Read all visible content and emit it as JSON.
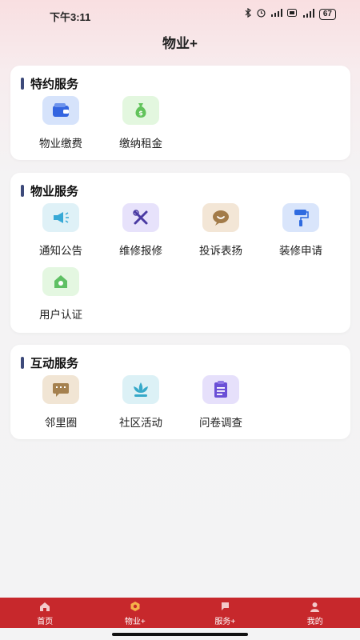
{
  "status": {
    "time": "下午3:11",
    "battery": "67"
  },
  "page": {
    "title": "物业+"
  },
  "sections": {
    "special": {
      "title": "特约服务",
      "items": [
        {
          "label": "物业缴费",
          "icon": "wallet-icon",
          "bg": "#d6e3fb",
          "fg": "#3465e0"
        },
        {
          "label": "缴纳租金",
          "icon": "money-bag-icon",
          "bg": "#e3f7df",
          "fg": "#62c35b"
        }
      ]
    },
    "property": {
      "title": "物业服务",
      "items": [
        {
          "label": "通知公告",
          "icon": "megaphone-icon",
          "bg": "#dff1f7",
          "fg": "#38a9d6"
        },
        {
          "label": "维修报修",
          "icon": "tools-icon",
          "bg": "#e7e2fb",
          "fg": "#4a3aa3"
        },
        {
          "label": "投诉表扬",
          "icon": "chat-smile-icon",
          "bg": "#f3e6d6",
          "fg": "#a27b49"
        },
        {
          "label": "装修申请",
          "icon": "paint-roller-icon",
          "bg": "#d9e5fb",
          "fg": "#2f6be0"
        },
        {
          "label": "用户认证",
          "icon": "home-verify-icon",
          "bg": "#e4f7e1",
          "fg": "#5fc064"
        }
      ]
    },
    "interactive": {
      "title": "互动服务",
      "items": [
        {
          "label": "邻里圈",
          "icon": "message-card-icon",
          "bg": "#f1e5d4",
          "fg": "#a5814f"
        },
        {
          "label": "社区活动",
          "icon": "lotus-icon",
          "bg": "#dcf1f6",
          "fg": "#36a9c9"
        },
        {
          "label": "问卷调查",
          "icon": "clipboard-icon",
          "bg": "#e6e0fb",
          "fg": "#6a4fd6"
        }
      ]
    }
  },
  "bottom_nav": [
    {
      "label": "首页",
      "icon": "home-icon"
    },
    {
      "label": "物业+",
      "icon": "hexagon-icon",
      "active": true
    },
    {
      "label": "服务+",
      "icon": "flag-icon"
    },
    {
      "label": "我的",
      "icon": "person-icon"
    }
  ]
}
